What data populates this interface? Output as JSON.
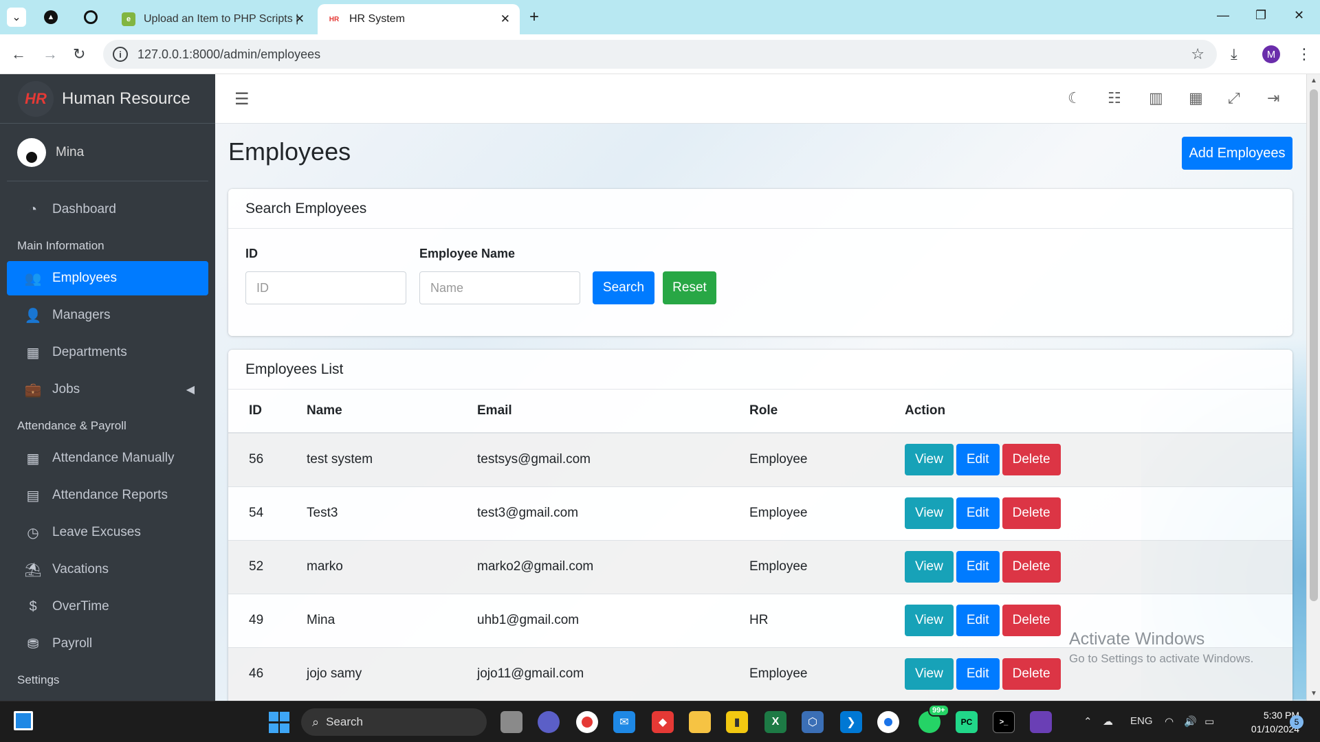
{
  "browser": {
    "tabs": [
      {
        "title": "Upload an Item to PHP Scripts |",
        "active": false
      },
      {
        "title": "HR System",
        "active": true
      }
    ],
    "url": "127.0.0.1:8000/admin/employees",
    "profile_initial": "M"
  },
  "sidebar": {
    "brand": "Human Resource",
    "brand_logo": "HR",
    "user": "Mina",
    "items": [
      {
        "label": "Dashboard",
        "icon": "dashboard-icon"
      },
      {
        "header": "Main Information"
      },
      {
        "label": "Employees",
        "icon": "users-icon",
        "active": true
      },
      {
        "label": "Managers",
        "icon": "user-icon"
      },
      {
        "label": "Departments",
        "icon": "building-icon"
      },
      {
        "label": "Jobs",
        "icon": "briefcase-icon"
      },
      {
        "header": "Attendance & Payroll"
      },
      {
        "label": "Attendance Manually",
        "icon": "calendar-icon"
      },
      {
        "label": "Attendance Reports",
        "icon": "file-icon"
      },
      {
        "label": "Leave Excuses",
        "icon": "clock-icon"
      },
      {
        "label": "Vacations",
        "icon": "umbrella-icon"
      },
      {
        "label": "OverTime",
        "icon": "dollar-icon"
      },
      {
        "label": "Payroll",
        "icon": "coins-icon"
      },
      {
        "header": "Settings"
      }
    ]
  },
  "page": {
    "title": "Employees",
    "add_button": "Add Employees",
    "search_card": {
      "title": "Search Employees",
      "id_label": "ID",
      "id_placeholder": "ID",
      "name_label": "Employee Name",
      "name_placeholder": "Name",
      "search_button": "Search",
      "reset_button": "Reset"
    },
    "list_card": {
      "title": "Employees List",
      "columns": [
        "ID",
        "Name",
        "Email",
        "Role",
        "Action"
      ],
      "rows": [
        {
          "id": "56",
          "name": "test system",
          "email": "testsys@gmail.com",
          "role": "Employee"
        },
        {
          "id": "54",
          "name": "Test3",
          "email": "test3@gmail.com",
          "role": "Employee"
        },
        {
          "id": "52",
          "name": "marko",
          "email": "marko2@gmail.com",
          "role": "Employee"
        },
        {
          "id": "49",
          "name": "Mina",
          "email": "uhb1@gmail.com",
          "role": "HR"
        },
        {
          "id": "46",
          "name": "jojo samy",
          "email": "jojo11@gmail.com",
          "role": "Employee"
        }
      ],
      "actions": {
        "view": "View",
        "edit": "Edit",
        "delete": "Delete"
      }
    }
  },
  "watermark": {
    "line1": "Activate Windows",
    "line2": "Go to Settings to activate Windows."
  },
  "taskbar": {
    "search": "Search",
    "lang": "ENG",
    "time": "5:30 PM",
    "date": "01/10/2024",
    "whatsapp_badge": "99+",
    "notif_count": "5"
  },
  "colors": {
    "primary": "#007bff",
    "success": "#28a745",
    "info": "#17a2b8",
    "danger": "#dc3545",
    "sidebar": "#343a40"
  }
}
